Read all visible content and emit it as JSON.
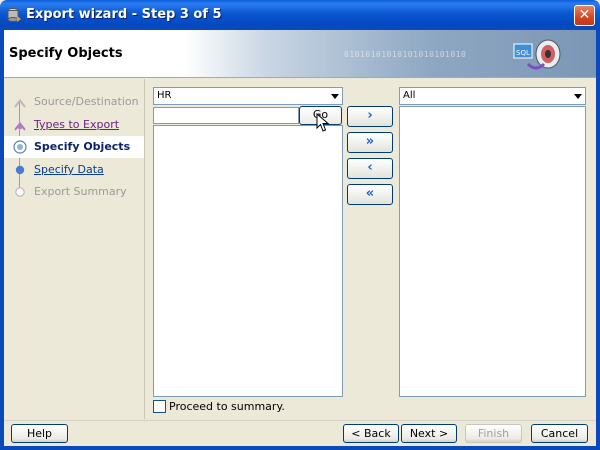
{
  "window": {
    "title": "Export wizard - Step 3 of 5"
  },
  "header": {
    "page_title": "Specify Objects",
    "binary_text": "01010101010101010101010"
  },
  "steps": [
    {
      "label": "Source/Destination",
      "state": "disabled"
    },
    {
      "label": "Types to Export",
      "state": "visited"
    },
    {
      "label": "Specify Objects",
      "state": "current"
    },
    {
      "label": "Specify Data",
      "state": "link"
    },
    {
      "label": "Export Summary",
      "state": "disabled"
    }
  ],
  "left_panel": {
    "schema_value": "HR",
    "search_value": "",
    "go_label": "Go"
  },
  "right_panel": {
    "filter_value": "All"
  },
  "move_buttons": {
    "add": "›",
    "add_all": "»",
    "remove": "‹",
    "remove_all": "«"
  },
  "proceed_label": "Proceed to summary.",
  "footer": {
    "help": "Help",
    "back": "< Back",
    "next": "Next >",
    "finish": "Finish",
    "cancel": "Cancel"
  },
  "colors": {
    "title_bar": "#0a57d0",
    "accent_link": "#0a3d91",
    "visited_link": "#6b1f85"
  }
}
